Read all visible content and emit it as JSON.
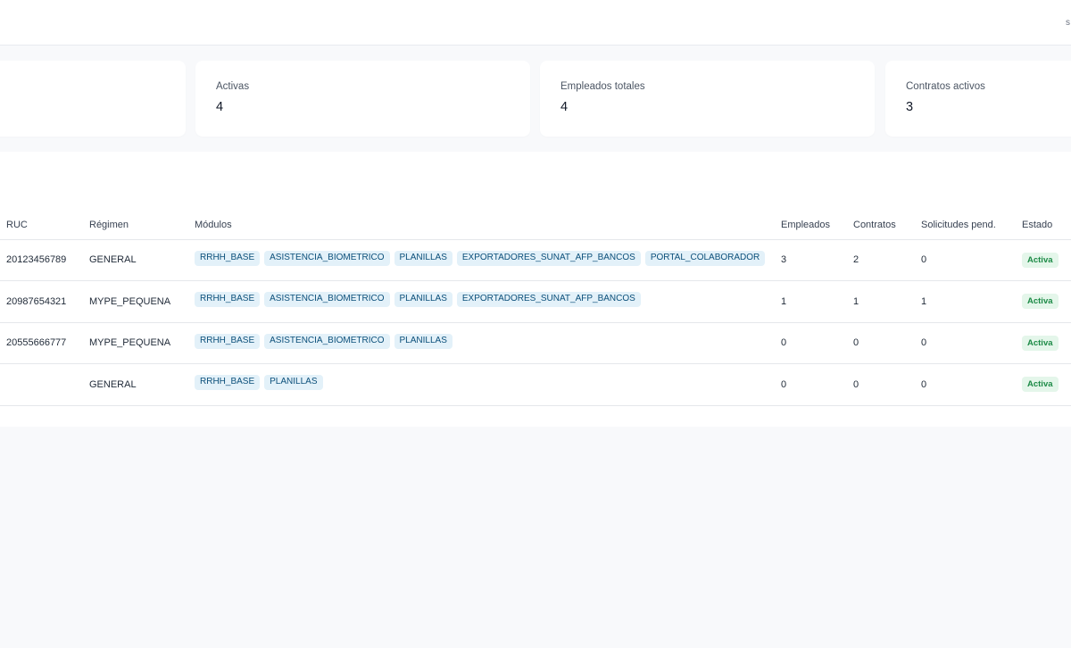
{
  "header": {
    "user_text": "s"
  },
  "stats": [
    {
      "label": "",
      "value": ""
    },
    {
      "label": "Activas",
      "value": "4"
    },
    {
      "label": "Empleados totales",
      "value": "4"
    },
    {
      "label": "Contratos activos",
      "value": "3"
    }
  ],
  "table": {
    "columns": [
      "RUC",
      "Régimen",
      "Módulos",
      "Empleados",
      "Contratos",
      "Solicitudes pend.",
      "Estado"
    ],
    "rows": [
      {
        "ruc": "20123456789",
        "regimen": "GENERAL",
        "modulos": [
          "RRHH_BASE",
          "ASISTENCIA_BIOMETRICO",
          "PLANILLAS",
          "EXPORTADORES_SUNAT_AFP_BANCOS",
          "PORTAL_COLABORADOR"
        ],
        "empleados": "3",
        "contratos": "2",
        "solicitudes": "0",
        "estado": "Activa"
      },
      {
        "ruc": "20987654321",
        "regimen": "MYPE_PEQUENA",
        "modulos": [
          "RRHH_BASE",
          "ASISTENCIA_BIOMETRICO",
          "PLANILLAS",
          "EXPORTADORES_SUNAT_AFP_BANCOS"
        ],
        "empleados": "1",
        "contratos": "1",
        "solicitudes": "1",
        "estado": "Activa"
      },
      {
        "ruc": "20555666777",
        "regimen": "MYPE_PEQUENA",
        "modulos": [
          "RRHH_BASE",
          "ASISTENCIA_BIOMETRICO",
          "PLANILLAS"
        ],
        "empleados": "0",
        "contratos": "0",
        "solicitudes": "0",
        "estado": "Activa"
      },
      {
        "ruc": "",
        "regimen": "GENERAL",
        "modulos": [
          "RRHH_BASE",
          "PLANILLAS"
        ],
        "empleados": "0",
        "contratos": "0",
        "solicitudes": "0",
        "estado": "Activa"
      }
    ]
  }
}
